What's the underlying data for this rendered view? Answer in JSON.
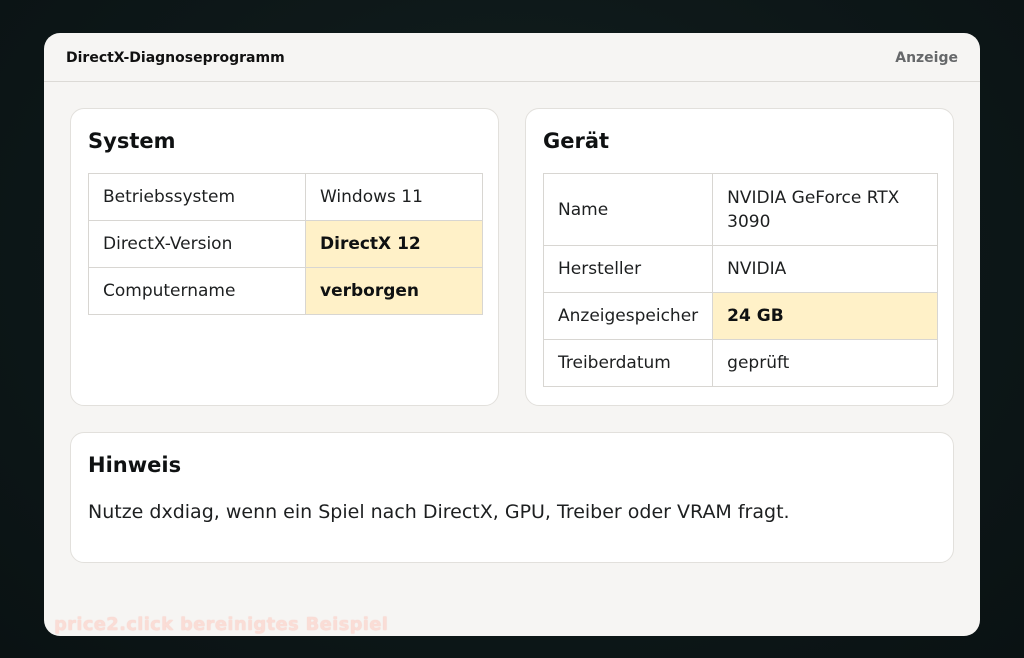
{
  "window": {
    "title": "DirectX-Diagnoseprogramm",
    "active_tab": "Anzeige"
  },
  "system": {
    "heading": "System",
    "rows": [
      {
        "key": "Betriebssystem",
        "value": "Windows 11",
        "highlight": false
      },
      {
        "key": "DirectX-Version",
        "value": "DirectX 12",
        "highlight": true
      },
      {
        "key": "Computername",
        "value": "verborgen",
        "highlight": true
      }
    ]
  },
  "geraet": {
    "heading": "Gerät",
    "rows": [
      {
        "key": "Name",
        "value": "NVIDIA GeForce RTX 3090",
        "highlight": false
      },
      {
        "key": "Hersteller",
        "value": "NVIDIA",
        "highlight": false
      },
      {
        "key": "Anzeigespeicher",
        "value": "24 GB",
        "highlight": true
      },
      {
        "key": "Treiberdatum",
        "value": "geprüft",
        "highlight": false
      }
    ]
  },
  "hinweis": {
    "heading": "Hinweis",
    "text": "Nutze dxdiag, wenn ein Spiel nach DirectX, GPU, Treiber oder VRAM fragt."
  },
  "watermark": "price2.click bereinigtes Beispiel",
  "colors": {
    "highlight": "#fff1c8",
    "panel_bg": "#f6f5f3",
    "backdrop": "#0d1718"
  }
}
